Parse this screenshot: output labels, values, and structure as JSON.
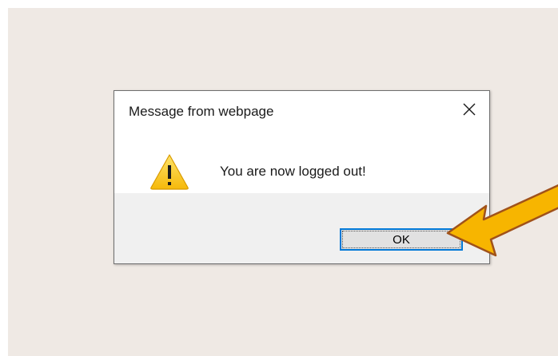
{
  "dialog": {
    "title": "Message from webpage",
    "message": "You are now logged out!",
    "ok_label": "OK",
    "icon": "warning-icon",
    "close_icon": "close-icon"
  },
  "annotation": {
    "icon": "arrow-pointer-icon",
    "fill_color": "#f7b500",
    "stroke_color": "#a0521a"
  },
  "colors": {
    "background": "#efe9e4",
    "dialog_footer": "#f0f0f0",
    "button_focus_border": "#0078d7",
    "warning_yellow": "#f8c20f"
  }
}
